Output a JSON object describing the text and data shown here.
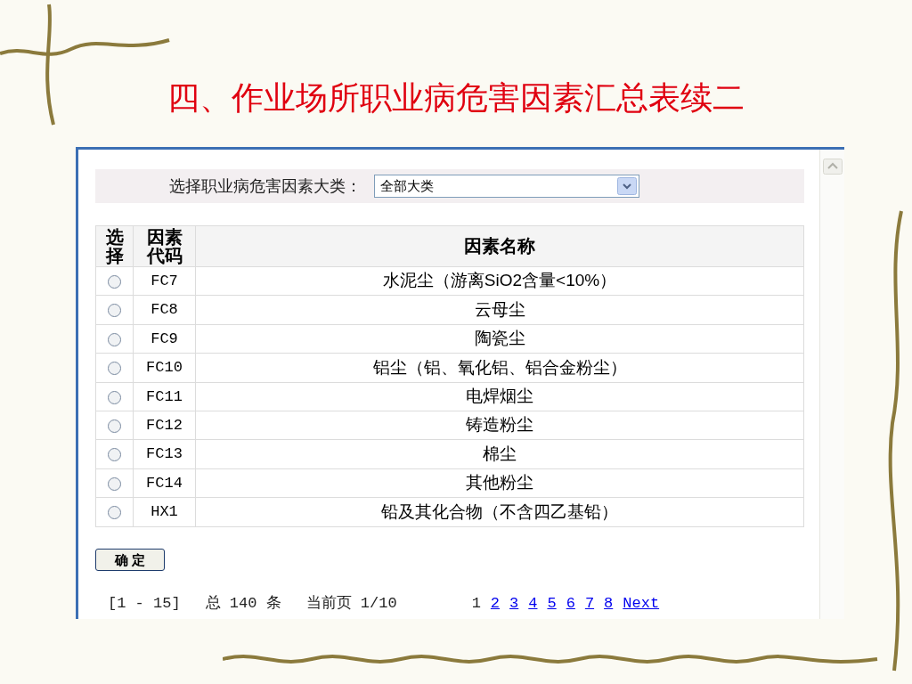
{
  "slide_title": "四、作业场所职业病危害因素汇总表续二",
  "filter": {
    "label": "选择职业病危害因素大类：",
    "value": "全部大类"
  },
  "table": {
    "columns": [
      "选择",
      "因素代码",
      "因素名称"
    ],
    "rows": [
      {
        "selected": false,
        "code": "FC7",
        "name": "水泥尘（游离SiO2含量<10%）"
      },
      {
        "selected": false,
        "code": "FC8",
        "name": "云母尘"
      },
      {
        "selected": false,
        "code": "FC9",
        "name": "陶瓷尘"
      },
      {
        "selected": false,
        "code": "FC10",
        "name": "铝尘（铝、氧化铝、铝合金粉尘）"
      },
      {
        "selected": false,
        "code": "FC11",
        "name": "电焊烟尘"
      },
      {
        "selected": false,
        "code": "FC12",
        "name": "铸造粉尘"
      },
      {
        "selected": false,
        "code": "FC13",
        "name": "棉尘"
      },
      {
        "selected": false,
        "code": "FC14",
        "name": "其他粉尘"
      },
      {
        "selected": false,
        "code": "HX1",
        "name": "铅及其化合物（不含四乙基铅）"
      }
    ]
  },
  "confirm_button": "确 定",
  "pagination": {
    "range": "[1 - 15]",
    "total": "总 140 条",
    "current": "当前页 1/10",
    "pages": [
      {
        "label": "1",
        "selected": true
      },
      {
        "label": "2",
        "selected": false
      },
      {
        "label": "3",
        "selected": false
      },
      {
        "label": "4",
        "selected": false
      },
      {
        "label": "5",
        "selected": false
      },
      {
        "label": "6",
        "selected": false
      },
      {
        "label": "7",
        "selected": false
      },
      {
        "label": "8",
        "selected": false
      }
    ],
    "next": "Next"
  }
}
